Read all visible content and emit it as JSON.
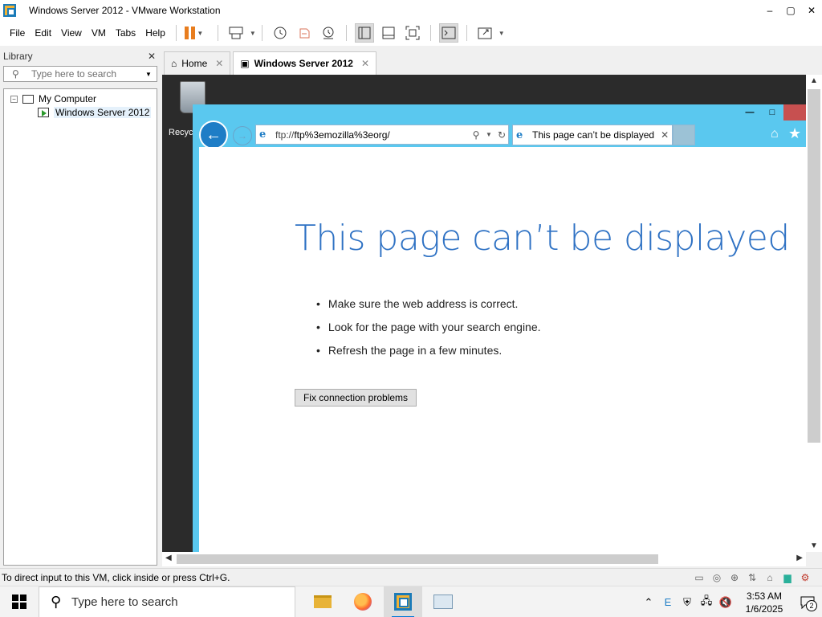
{
  "window": {
    "title": "Windows Server 2012 - VMware Workstation",
    "controls": {
      "minimize": "–",
      "maximize": "▢",
      "close": "✕"
    }
  },
  "menubar": {
    "items": [
      "File",
      "Edit",
      "View",
      "VM",
      "Tabs",
      "Help"
    ]
  },
  "library": {
    "title": "Library",
    "close": "✕",
    "search_placeholder": "Type here to search",
    "tree": {
      "root": "My Computer",
      "root_expander": "−",
      "child": "Windows Server 2012"
    }
  },
  "tabs": [
    {
      "label": "Home",
      "icon": "home-icon",
      "close": "✕"
    },
    {
      "label": "Windows Server 2012",
      "icon": "vm-icon",
      "close": "✕",
      "active": true
    }
  ],
  "vm": {
    "desktop": {
      "recycle_label": "Recyc"
    },
    "ie": {
      "address_scheme": "ftp://",
      "address_host": "ftp%3emozilla%3eorg/",
      "tab_title": "This page can’t be displayed",
      "tab_close": "✕",
      "back": "←",
      "forward": "→",
      "home": "⌂",
      "favorites": "★",
      "win_controls": {
        "minimize": "—",
        "maximize": "□",
        "close": ""
      }
    },
    "error_page": {
      "title": "This page can’t be displayed",
      "bullets": [
        "Make sure the web address is correct.",
        "Look for the page with your search engine.",
        "Refresh the page in a few minutes."
      ],
      "fix_button": "Fix connection problems"
    }
  },
  "statusbar": {
    "text": "To direct input to this VM, click inside or press Ctrl+G."
  },
  "taskbar": {
    "search_placeholder": "Type here to search",
    "apps": [
      "file-explorer-icon",
      "firefox-icon",
      "vmware-workstation-icon",
      "network-app-icon"
    ],
    "clock_time": "3:53 AM",
    "clock_date": "1/6/2025",
    "notification_count": "2"
  },
  "colors": {
    "ie_frame": "#5ac8ef",
    "error_title": "#2f72c4",
    "vmware_accent": "#f2b233",
    "pause_orange": "#e87d1e"
  }
}
